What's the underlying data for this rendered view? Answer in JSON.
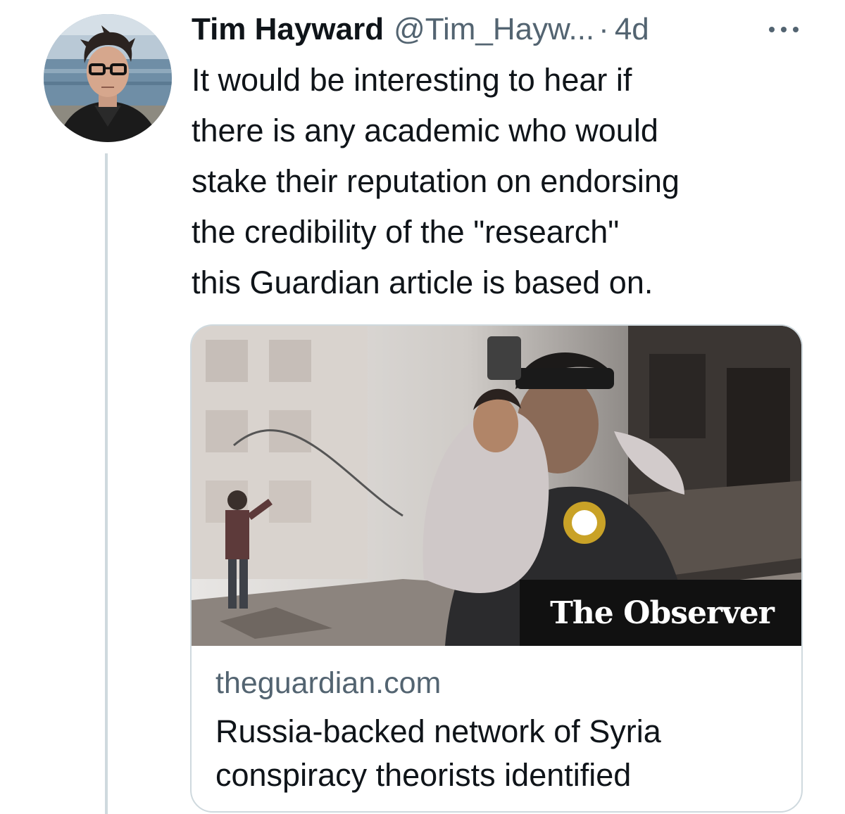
{
  "tweet": {
    "author": {
      "display_name": "Tim Hayward",
      "handle": "@Tim_Hayw...",
      "avatar_icon": "profile-photo"
    },
    "separator": "·",
    "timestamp": "4d",
    "more_icon": "ellipsis-icon",
    "text": "It would be interesting to hear if\nthere is any academic who would\nstake their reputation on endorsing\nthe credibility of the \"research\"\nthis Guardian article is based on.",
    "link_card": {
      "image_badge": "The Observer",
      "domain": "theguardian.com",
      "title": "Russia-backed network of Syria\nconspiracy theorists identified"
    }
  },
  "colors": {
    "primary_text": "#0f1419",
    "secondary_text": "#536471",
    "border": "#cfd9de",
    "thread_line": "#cfd9de"
  }
}
